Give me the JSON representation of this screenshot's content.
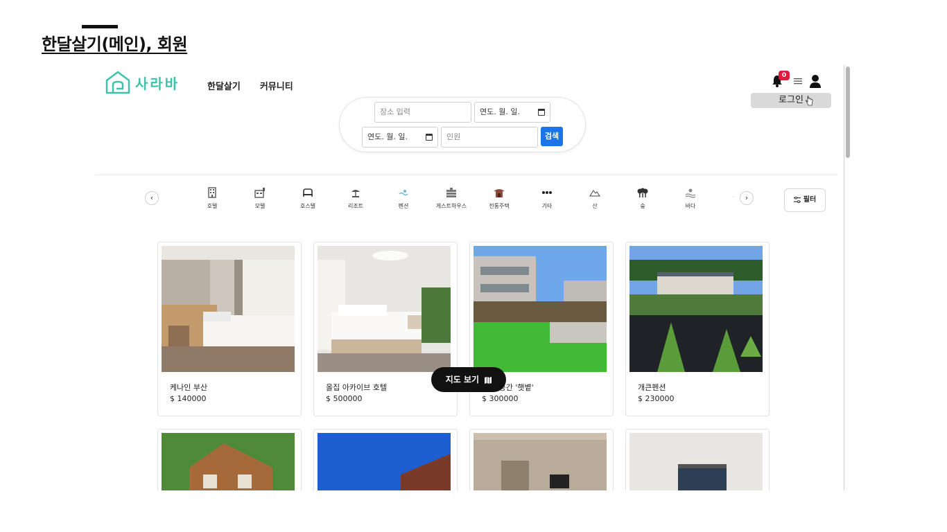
{
  "slide": {
    "title": "한달살기(메인), 회원"
  },
  "header": {
    "brand": "사라바",
    "brand_color": "#3ac3a8",
    "nav": [
      "한달살기",
      "커뮤니티"
    ],
    "notification_count": "0",
    "login_label": "로그인"
  },
  "search": {
    "location_placeholder": "장소 입력",
    "checkin_value": "연도. 월. 일.",
    "checkout_value": "연도. 월. 일.",
    "guests_placeholder": "인원",
    "search_label": "검색"
  },
  "categories": [
    {
      "label": "호텔",
      "icon": "hotel-icon"
    },
    {
      "label": "모텔",
      "icon": "motel-icon"
    },
    {
      "label": "호스텔",
      "icon": "hostel-icon"
    },
    {
      "label": "리조트",
      "icon": "resort-icon"
    },
    {
      "label": "펜션",
      "icon": "pension-icon"
    },
    {
      "label": "게스트하우스",
      "icon": "guesthouse-icon"
    },
    {
      "label": "전통주택",
      "icon": "hanok-icon"
    },
    {
      "label": "기타",
      "icon": "more-icon"
    },
    {
      "label": "산",
      "icon": "mountain-icon"
    },
    {
      "label": "숲",
      "icon": "forest-icon"
    },
    {
      "label": "바다",
      "icon": "sea-icon"
    }
  ],
  "filter_label": "필터",
  "listings": [
    {
      "title": "케나인 부산",
      "price": "$ 140000"
    },
    {
      "title": "올집 아카이브 호텔",
      "price": "$ 500000"
    },
    {
      "title": "…의 공간 '햇볕'",
      "price": "$ 300000"
    },
    {
      "title": "개큰펜션",
      "price": "$ 230000"
    }
  ],
  "map_button_label": "지도 보기",
  "accent_blue": "#1b74e8",
  "badge_red": "#e0193f"
}
